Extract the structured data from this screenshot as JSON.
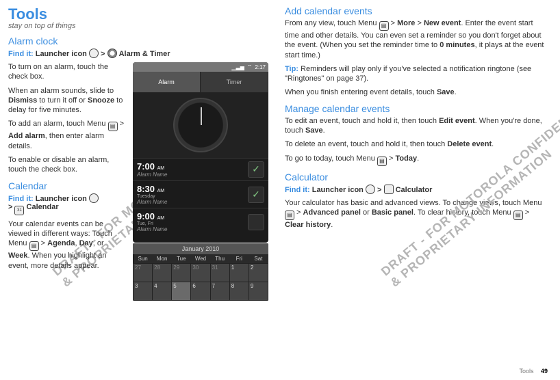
{
  "footer": {
    "section": "Tools",
    "page": "49"
  },
  "watermark": {
    "line1": "DRAFT - FOR MOTOROLA CONFIDENTIAL",
    "line2": "& PROPRIETARY INFORMATION"
  },
  "left": {
    "chapter": "Tools",
    "subtitle": "stay on top of things",
    "alarm": {
      "heading": "Alarm clock",
      "find_label": "Find it: ",
      "find_path_a": "Launcher icon",
      "find_sep": " > ",
      "find_path_b": " Alarm & Timer",
      "p1a": "To turn on an alarm, touch the check box.",
      "p2a": "When an alarm sounds, slide to ",
      "p2b": "Dismiss",
      "p2c": " to turn it off or ",
      "p2d": "Snooze",
      "p2e": " to delay for five minutes.",
      "p3a": "To add an alarm, touch Menu ",
      "p3b": " > ",
      "p3c": "Add alarm",
      "p3d": ", then enter alarm details.",
      "p4": "To enable or disable an alarm, touch the check box."
    },
    "cal": {
      "heading": "Calendar",
      "find_label": "Find it: ",
      "find_path_a": "Launcher icon",
      "find_sep": " > ",
      "find_path_b": " Calendar",
      "p1a": "Your calendar events can be viewed in different ways: Touch Menu ",
      "p1b": " > ",
      "p1c": "Agenda",
      "p1d": ", ",
      "p1e": "Day",
      "p1f": ", or ",
      "p1g": "Week",
      "p1h": ". When you highlight an event, more details appear."
    }
  },
  "phone_alarm": {
    "status": {
      "time": "2:17",
      "sig": "▁▃▅",
      "wifi": "⌔"
    },
    "tabs": {
      "alarm": "Alarm",
      "timer": "Timer"
    },
    "rows": [
      {
        "time": "7:00",
        "ampm": "AM",
        "days": "",
        "name": "Alarm Name",
        "checked": true
      },
      {
        "time": "8:30",
        "ampm": "AM",
        "days": "Tuesday",
        "name": "Alarm Name",
        "checked": true
      },
      {
        "time": "9:00",
        "ampm": "AM",
        "days": "Tue, Fri",
        "name": "Alarm Name",
        "checked": false
      }
    ]
  },
  "phone_cal": {
    "title": "January 2010",
    "dow": [
      "Sun",
      "Mon",
      "Tue",
      "Wed",
      "Thu",
      "Fri",
      "Sat"
    ],
    "rows": [
      [
        {
          "n": "27",
          "d": 1
        },
        {
          "n": "28",
          "d": 1
        },
        {
          "n": "29",
          "d": 1
        },
        {
          "n": "30",
          "d": 1
        },
        {
          "n": "31",
          "d": 1
        },
        {
          "n": "1",
          "d": 0
        },
        {
          "n": "2",
          "d": 0
        }
      ],
      [
        {
          "n": "3",
          "d": 0
        },
        {
          "n": "4",
          "d": 0
        },
        {
          "n": "5",
          "d": 0,
          "t": 1
        },
        {
          "n": "6",
          "d": 0
        },
        {
          "n": "7",
          "d": 0
        },
        {
          "n": "8",
          "d": 0
        },
        {
          "n": "9",
          "d": 0
        }
      ]
    ]
  },
  "right": {
    "add": {
      "heading": "Add calendar events",
      "p1a": "From any view, touch Menu ",
      "p1b": " > ",
      "p1c": "More",
      "p1d": " > ",
      "p1e": "New event",
      "p1f": ". Enter the event start time and other details. You can even set a reminder so you don't forget about the event. (When you set the reminder time to ",
      "p1g": "0 minutes",
      "p1h": ", it plays at the event start time.)",
      "tip_label": "Tip: ",
      "tip": "Reminders will play only if you've selected a notification ringtone (see \"Ringtones\" on page 37).",
      "p2a": "When you finish entering event details, touch ",
      "p2b": "Save",
      "p2c": "."
    },
    "manage": {
      "heading": "Manage calendar events",
      "p1a": "To edit an event, touch and hold it, then touch ",
      "p1b": "Edit event",
      "p1c": ". When you're done, touch ",
      "p1d": "Save",
      "p1e": ".",
      "p2a": "To delete an event, touch and hold it, then touch ",
      "p2b": "Delete event",
      "p2c": ".",
      "p3a": "To go to today, touch Menu ",
      "p3b": " > ",
      "p3c": "Today",
      "p3d": "."
    },
    "calc": {
      "heading": "Calculator",
      "find_label": "Find it: ",
      "find_path_a": "Launcher icon",
      "find_sep": " > ",
      "find_path_b": " Calculator",
      "p1a": "Your calculator has basic and advanced views. To change views, touch Menu ",
      "p1b": " > ",
      "p1c": "Advanced panel",
      "p1d": " or ",
      "p1e": "Basic panel",
      "p1f": ". To clear history, touch Menu ",
      "p1g": " > ",
      "p1h": "Clear history",
      "p1i": "."
    }
  }
}
